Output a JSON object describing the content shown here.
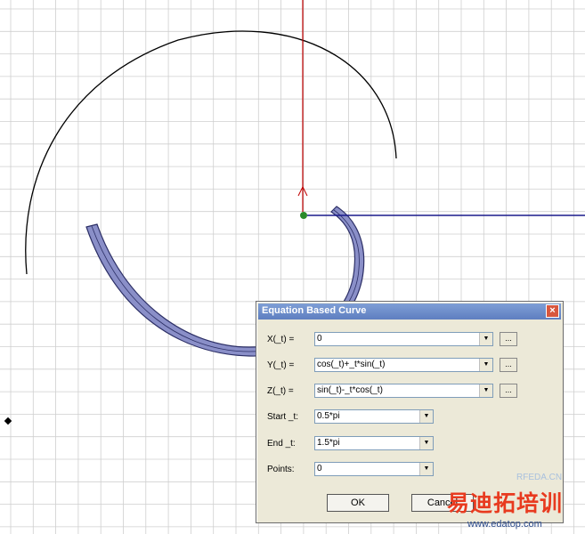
{
  "dialog": {
    "title": "Equation Based Curve",
    "rows": [
      {
        "label": "X(_t) =",
        "value": "0",
        "has_browse": true
      },
      {
        "label": "Y(_t) =",
        "value": "cos(_t)+_t*sin(_t)",
        "has_browse": true
      },
      {
        "label": "Z(_t) =",
        "value": "sin(_t)-_t*cos(_t)",
        "has_browse": true
      },
      {
        "label": "Start _t:",
        "value": "0.5*pi",
        "has_browse": false
      },
      {
        "label": "End _t:",
        "value": "1.5*pi",
        "has_browse": false
      },
      {
        "label": "Points:",
        "value": "0",
        "has_browse": false
      }
    ],
    "browse_label": "...",
    "ok_label": "OK",
    "cancel_label": "Cancel",
    "close_glyph": "×"
  },
  "watermark": {
    "site": "RFEDA.CN",
    "brand": "易迪拓培训",
    "url": "www.edatop.com"
  },
  "colors": {
    "grid": "#cfcfcf",
    "axis_vertical": "#c00000",
    "axis_horizontal": "#1a1a8c",
    "profile_fill": "#8a8fc8",
    "origin": "#2a8a2a"
  }
}
